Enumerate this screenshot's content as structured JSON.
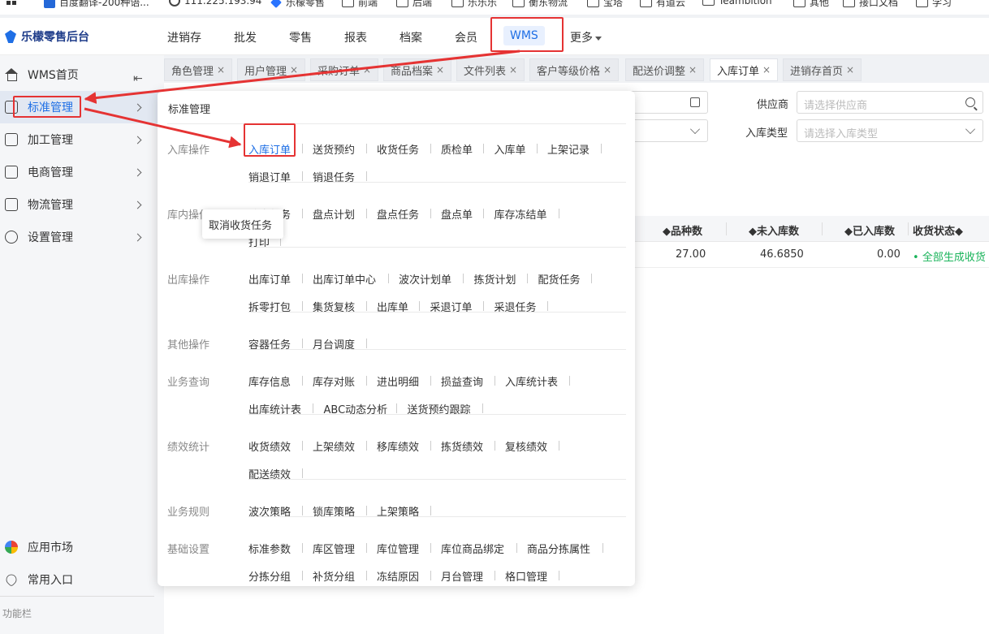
{
  "bookmarks": [
    {
      "label": "百度翻译-200种语..."
    },
    {
      "label": "111.225.193.94"
    },
    {
      "label": "乐檬零售"
    },
    {
      "label": "前端"
    },
    {
      "label": "后端"
    },
    {
      "label": "乐乐乐"
    },
    {
      "label": "衡东物流"
    },
    {
      "label": "宝塔"
    },
    {
      "label": "有道云"
    },
    {
      "label": "Teambition"
    },
    {
      "label": "其他"
    },
    {
      "label": "接口文档"
    },
    {
      "label": "学习"
    }
  ],
  "app": {
    "title": "乐檬零售后台"
  },
  "top_nav": [
    {
      "label": "进销存"
    },
    {
      "label": "批发"
    },
    {
      "label": "零售"
    },
    {
      "label": "报表"
    },
    {
      "label": "档案"
    },
    {
      "label": "会员"
    },
    {
      "label": "WMS"
    },
    {
      "label": "更多"
    }
  ],
  "sidebar": {
    "home": "WMS首页",
    "items": [
      {
        "label": "标准管理"
      },
      {
        "label": "加工管理"
      },
      {
        "label": "电商管理"
      },
      {
        "label": "物流管理"
      },
      {
        "label": "设置管理"
      }
    ],
    "bottom": [
      {
        "label": "应用市场"
      },
      {
        "label": "常用入口"
      }
    ],
    "func_bar": "功能栏"
  },
  "tabs": [
    {
      "label": "角色管理"
    },
    {
      "label": "用户管理"
    },
    {
      "label": "采购订单"
    },
    {
      "label": "商品档案"
    },
    {
      "label": "文件列表"
    },
    {
      "label": "客户等级价格"
    },
    {
      "label": "配送价调整"
    },
    {
      "label": "入库订单"
    },
    {
      "label": "进销存首页"
    }
  ],
  "close_glyph": "×",
  "filters": {
    "supplier_label": "供应商",
    "supplier_placeholder": "请选择供应商",
    "type_label": "入库类型",
    "type_placeholder": "请选择入库类型"
  },
  "table": {
    "headers": [
      "品种数",
      "未入库数",
      "已入库数",
      "收货状态"
    ],
    "row": [
      "27.00",
      "46.6850",
      "0.00",
      "全部生成收货"
    ]
  },
  "menu": {
    "title": "标准管理",
    "sections": [
      {
        "category": "入库操作",
        "rows": [
          [
            "入库订单",
            "送货预约",
            "收货任务",
            "质检单",
            "入库单",
            "上架记录"
          ],
          [
            "销退订单",
            "销退任务"
          ]
        ]
      },
      {
        "category": "库内操作",
        "rows": [
          [
            "移库任务",
            "盘点计划",
            "盘点任务",
            "盘点单",
            "库存冻结单"
          ],
          [
            "打印"
          ]
        ]
      },
      {
        "category": "出库操作",
        "rows": [
          [
            "出库订单",
            "出库订单中心",
            "波次计划单",
            "拣货计划",
            "配货任务"
          ],
          [
            "拆零打包",
            "集货复核",
            "出库单",
            "采退订单",
            "采退任务"
          ]
        ]
      },
      {
        "category": "其他操作",
        "rows": [
          [
            "容器任务",
            "月台调度"
          ]
        ]
      },
      {
        "category": "业务查询",
        "rows": [
          [
            "库存信息",
            "库存对账",
            "进出明细",
            "损益查询",
            "入库统计表"
          ],
          [
            "出库统计表",
            "ABC动态分析",
            "送货预约跟踪"
          ]
        ]
      },
      {
        "category": "绩效统计",
        "rows": [
          [
            "收货绩效",
            "上架绩效",
            "移库绩效",
            "拣货绩效",
            "复核绩效"
          ],
          [
            "配送绩效"
          ]
        ]
      },
      {
        "category": "业务规则",
        "rows": [
          [
            "波次策略",
            "锁库策略",
            "上架策略"
          ]
        ]
      },
      {
        "category": "基础设置",
        "rows": [
          [
            "标准参数",
            "库区管理",
            "库位管理",
            "库位商品绑定",
            "商品分拣属性"
          ],
          [
            "分拣分组",
            "补货分组",
            "冻结原因",
            "月台管理",
            "格口管理"
          ]
        ]
      }
    ]
  },
  "tooltip": "取消收货任务",
  "colors": {
    "accent": "#1f6fe5",
    "annotation": "#e53333",
    "status_green": "#19b35a"
  }
}
